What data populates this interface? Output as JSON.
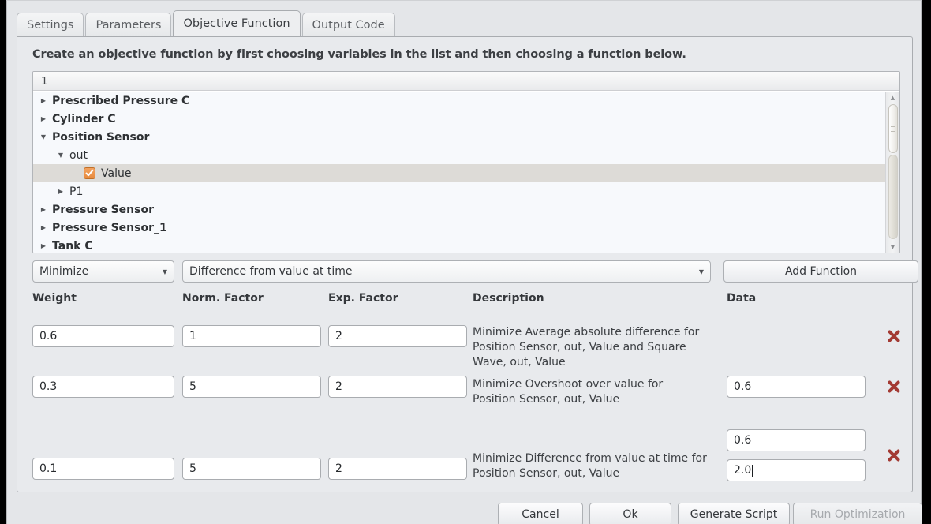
{
  "tabs": [
    {
      "label": "Settings",
      "active": false
    },
    {
      "label": "Parameters",
      "active": false
    },
    {
      "label": "Objective Function",
      "active": true
    },
    {
      "label": "Output Code",
      "active": false
    }
  ],
  "instruction": "Create an objective function by first choosing variables in the list and then choosing a function below.",
  "tree": {
    "column_header": "1",
    "rows": [
      {
        "label": "Prescribed Pressure C",
        "indent": 0,
        "twisty": "collapsed",
        "bold": true,
        "checkbox": false,
        "selected": false
      },
      {
        "label": "Cylinder C",
        "indent": 0,
        "twisty": "collapsed",
        "bold": true,
        "checkbox": false,
        "selected": false
      },
      {
        "label": "Position Sensor",
        "indent": 0,
        "twisty": "expanded",
        "bold": true,
        "checkbox": false,
        "selected": false
      },
      {
        "label": "out",
        "indent": 1,
        "twisty": "expanded",
        "bold": false,
        "checkbox": false,
        "selected": false
      },
      {
        "label": "Value",
        "indent": 2,
        "twisty": "none",
        "bold": false,
        "checkbox": true,
        "selected": true
      },
      {
        "label": "P1",
        "indent": 1,
        "twisty": "collapsed",
        "bold": false,
        "checkbox": false,
        "selected": false
      },
      {
        "label": "Pressure Sensor",
        "indent": 0,
        "twisty": "collapsed",
        "bold": true,
        "checkbox": false,
        "selected": false
      },
      {
        "label": "Pressure Sensor_1",
        "indent": 0,
        "twisty": "collapsed",
        "bold": true,
        "checkbox": false,
        "selected": false
      },
      {
        "label": "Tank C",
        "indent": 0,
        "twisty": "collapsed",
        "bold": true,
        "checkbox": false,
        "selected": false
      }
    ]
  },
  "controls": {
    "goal": "Minimize",
    "function": "Difference from value at time",
    "add_function_label": "Add Function"
  },
  "columns": {
    "weight": "Weight",
    "norm_factor": "Norm. Factor",
    "exp_factor": "Exp. Factor",
    "description": "Description",
    "data": "Data"
  },
  "objectives": [
    {
      "weight": "0.6",
      "norm_factor": "1",
      "exp_factor": "2",
      "description": "Minimize Average absolute difference for Position Sensor, out, Value and Square Wave, out, Value",
      "data": [],
      "delete_icon": "x-icon"
    },
    {
      "weight": "0.3",
      "norm_factor": "5",
      "exp_factor": "2",
      "description": "Minimize Overshoot over value for Position Sensor, out, Value",
      "data": [
        "0.6"
      ],
      "delete_icon": "x-icon"
    },
    {
      "weight": "0.1",
      "norm_factor": "5",
      "exp_factor": "2",
      "description": "Minimize Difference from value at time for Position Sensor, out, Value",
      "data": [
        "0.6",
        "2.0"
      ],
      "delete_icon": "x-icon"
    }
  ],
  "footer": {
    "cancel": "Cancel",
    "ok": "Ok",
    "generate_script": "Generate Script",
    "run_optimization": "Run Optimization"
  },
  "colors": {
    "checkbox_orange": "#e88a3c",
    "delete_x_red": "#a33a33",
    "selection_gray": "#dddbd7"
  }
}
